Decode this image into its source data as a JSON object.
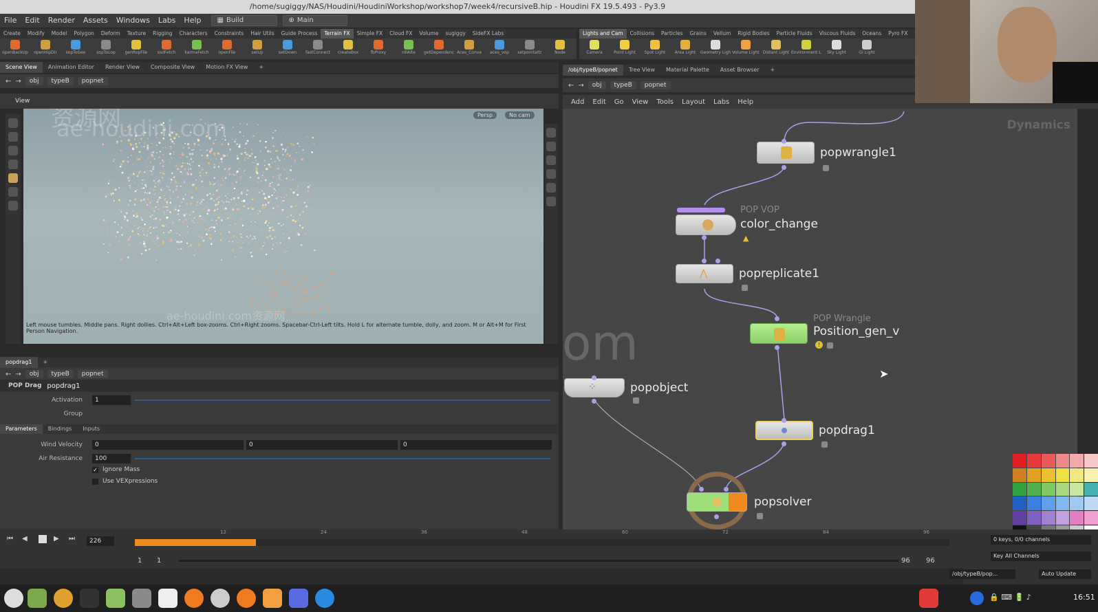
{
  "window": {
    "title": "/home/sugiggy/NAS/Houdini/HoudiniWorkshop/workshop7/week4/recursiveB.hip - Houdini FX 19.5.493 - Py3.9"
  },
  "menubar": {
    "items": [
      "File",
      "Edit",
      "Render",
      "Assets",
      "Windows",
      "Labs",
      "Help"
    ],
    "desktop": "Build",
    "context": "Main"
  },
  "shelf_left": {
    "tabs": [
      "Create",
      "Modify",
      "Model",
      "Polygon",
      "Deform",
      "Texture",
      "Rigging",
      "Characters",
      "Constraints",
      "Hair Utils",
      "Guide Process",
      "Terrain FX",
      "Simple FX",
      "Cloud FX",
      "Volume",
      "sugiggy",
      "SideFX Labs"
    ],
    "active_tab": "Terrain FX",
    "tools": [
      "openBackUp",
      "openHipDir",
      "sopToGeo",
      "sopToLop",
      "genRopFile",
      "ssdFetch",
      "karmaFetch",
      "openFile",
      "setUp",
      "setDown",
      "fastConnect",
      "createBox",
      "fbProxy",
      "rdlAlte",
      "getDependency",
      "Aces_Conve",
      "aces_vop",
      "setpointattr",
      "Node"
    ]
  },
  "shelf_right": {
    "tabs": [
      "Lights and Cam",
      "Collisions",
      "Particles",
      "Grains",
      "Vellum",
      "Rigid Bodies",
      "Particle Fluids",
      "Viscous Fluids",
      "Oceans",
      "Pyro FX"
    ],
    "active_tab": "Lights and Cam",
    "tools": [
      "Camera",
      "Point Light",
      "Spot Light",
      "Area Light",
      "Geometry Light",
      "Volume Light",
      "Distant Light",
      "Environment Light",
      "Sky Light",
      "GI Light"
    ]
  },
  "left_pane": {
    "tabs": [
      "Scene View",
      "Animation Editor",
      "Render View",
      "Composite View",
      "Motion FX View"
    ],
    "path": [
      "obj",
      "typeB",
      "popnet"
    ],
    "view_label": "View",
    "persp_button": "Persp",
    "cam_button": "No cam",
    "hint_line1": "Left mouse tumbles. Middle pans. Right dollies. Ctrl+Alt+Left box-zooms. Ctrl+Right zooms. Spacebar-Ctrl-Left tilts. Hold L for alternate tumble, dolly, and zoom.    M or Alt+M for First",
    "hint_line2": "Person Navigation."
  },
  "params": {
    "tab": "popdrag1",
    "path": [
      "obj",
      "typeB",
      "popnet"
    ],
    "node_type": "POP Drag",
    "node_name": "popdrag1",
    "activation_label": "Activation",
    "activation_value": "1",
    "group_label": "Group",
    "subtabs": [
      "Parameters",
      "Bindings",
      "Inputs"
    ],
    "wind_velocity_label": "Wind Velocity",
    "wind_velocity": [
      "0",
      "0",
      "0"
    ],
    "air_resistance_label": "Air Resistance",
    "air_resistance": "100",
    "ignore_mass": "Ignore Mass",
    "use_vex": "Use VEXpressions"
  },
  "network": {
    "tabs": [
      "/obj/typeB/popnet",
      "Tree View",
      "Material Palette",
      "Asset Browser"
    ],
    "path": [
      "obj",
      "typeB",
      "popnet"
    ],
    "menu": [
      "Add",
      "Edit",
      "Go",
      "View",
      "Tools",
      "Layout",
      "Labs",
      "Help"
    ],
    "context_label": "Dynamics",
    "nodes": [
      {
        "name": "popwrangle1",
        "type": ""
      },
      {
        "name": "color_change",
        "type": "POP VOP"
      },
      {
        "name": "popreplicate1",
        "type": ""
      },
      {
        "name": "Position_gen_v",
        "type": "POP Wrangle"
      },
      {
        "name": "popobject",
        "type": ""
      },
      {
        "name": "popdrag1",
        "type": ""
      },
      {
        "name": "popsolver",
        "type": ""
      }
    ]
  },
  "timeline": {
    "current_frame": "226",
    "start": "1",
    "start2": "1",
    "end": "96",
    "end2": "96",
    "ticks": [
      "12",
      "24",
      "36",
      "48",
      "60",
      "72",
      "84",
      "96"
    ],
    "keys_label": "0 keys, 0/0 channels",
    "key_all": "Key All Channels",
    "path_field": "/obj/typeB/pop...",
    "auto_update": "Auto Update"
  },
  "taskbar": {
    "clock": "16:51"
  },
  "watermarks": {
    "cn": "资源网",
    "site": "ae-houdini.com",
    "big": "mvrx.com",
    "site2": "ae-houdini.com资源网"
  },
  "colors": {
    "accent_orange": "#f08a1e",
    "node_green": "#9de07a",
    "node_purple": "#b48ef0",
    "selection_yellow": "#f0d25a"
  }
}
